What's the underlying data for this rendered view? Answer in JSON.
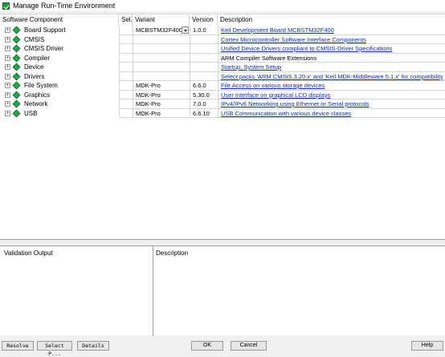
{
  "window": {
    "title": "Manage Run-Time Environment"
  },
  "table": {
    "headers": {
      "component": "Software Component",
      "sel": "Sel.",
      "variant": "Variant",
      "version": "Version",
      "description": "Description"
    },
    "rows": [
      {
        "name": "Board Support",
        "variant": "MCBSTM32F400",
        "version": "1.0.0",
        "description": "Keil Development Board MCBSTM32F400",
        "is_link": true
      },
      {
        "name": "CMSIS",
        "variant": "",
        "version": "",
        "description": "Cortex Microcontroller Software Interface Components",
        "is_link": true
      },
      {
        "name": "CMSIS Driver",
        "variant": "",
        "version": "",
        "description": "Unified Device Drivers compliant to CMSIS-Driver Specifications",
        "is_link": true
      },
      {
        "name": "Compiler",
        "variant": "",
        "version": "",
        "description": "ARM Compiler Software Extensions",
        "is_link": false
      },
      {
        "name": "Device",
        "variant": "",
        "version": "",
        "description": "Startup, System Setup",
        "is_link": true
      },
      {
        "name": "Drivers",
        "variant": "",
        "version": "",
        "description": "Select packs 'ARM.CMSIS.3.20.x' and 'Keil.MDK-Middleware.5.1.x' for compatibility",
        "is_link": true
      },
      {
        "name": "File System",
        "variant": "MDK-Pro",
        "version": "6.6.0",
        "description": "File Access on various storage devices",
        "is_link": true
      },
      {
        "name": "Graphics",
        "variant": "MDK-Pro",
        "version": "5.30.0",
        "description": "User Interface on graphical LCD displays",
        "is_link": true
      },
      {
        "name": "Network",
        "variant": "MDK-Pro",
        "version": "7.0.0",
        "description": "IPv4/IPv6 Networking using Ethernet or Serial protocols",
        "is_link": true
      },
      {
        "name": "USB",
        "variant": "MDK-Pro",
        "version": "6.6.10",
        "description": "USB Communication with various device classes",
        "is_link": true
      }
    ]
  },
  "validation": {
    "output_header": "Validation Output",
    "description_header": "Description"
  },
  "buttons": {
    "resolve": "Resolve",
    "select_packs": "Select P...",
    "details": "Details",
    "ok": "OK",
    "cancel": "Cancel",
    "help": "Help"
  },
  "colors": {
    "link": "#0b2bd1",
    "component_icon": "#24a84a"
  }
}
